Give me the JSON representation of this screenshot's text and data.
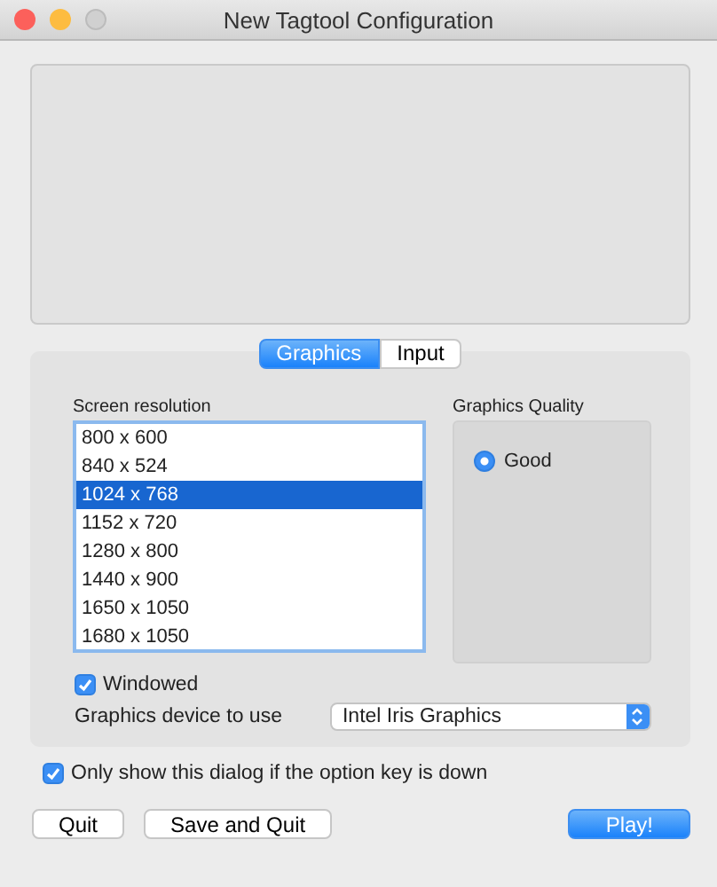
{
  "window": {
    "title": "New Tagtool Configuration"
  },
  "tabs": [
    {
      "label": "Graphics",
      "selected": true
    },
    {
      "label": "Input",
      "selected": false
    }
  ],
  "resolution": {
    "label": "Screen resolution",
    "items": [
      {
        "label": "800 x 600",
        "selected": false
      },
      {
        "label": "840 x 524",
        "selected": false
      },
      {
        "label": "1024 x 768",
        "selected": true
      },
      {
        "label": "1152 x 720",
        "selected": false
      },
      {
        "label": "1280 x 800",
        "selected": false
      },
      {
        "label": "1440 x 900",
        "selected": false
      },
      {
        "label": "1650 x 1050",
        "selected": false
      },
      {
        "label": "1680 x 1050",
        "selected": false
      }
    ]
  },
  "quality": {
    "label": "Graphics Quality",
    "options": [
      {
        "label": "Good",
        "selected": true
      }
    ]
  },
  "windowed": {
    "label": "Windowed",
    "checked": true
  },
  "device": {
    "label": "Graphics device to use",
    "value": "Intel Iris Graphics"
  },
  "only_show": {
    "label": "Only show this dialog if the option key is down",
    "checked": true
  },
  "buttons": [
    {
      "label": "Quit",
      "kind": "plain"
    },
    {
      "label": "Save and Quit",
      "kind": "plain"
    },
    {
      "label": "Play!",
      "kind": "default"
    }
  ]
}
